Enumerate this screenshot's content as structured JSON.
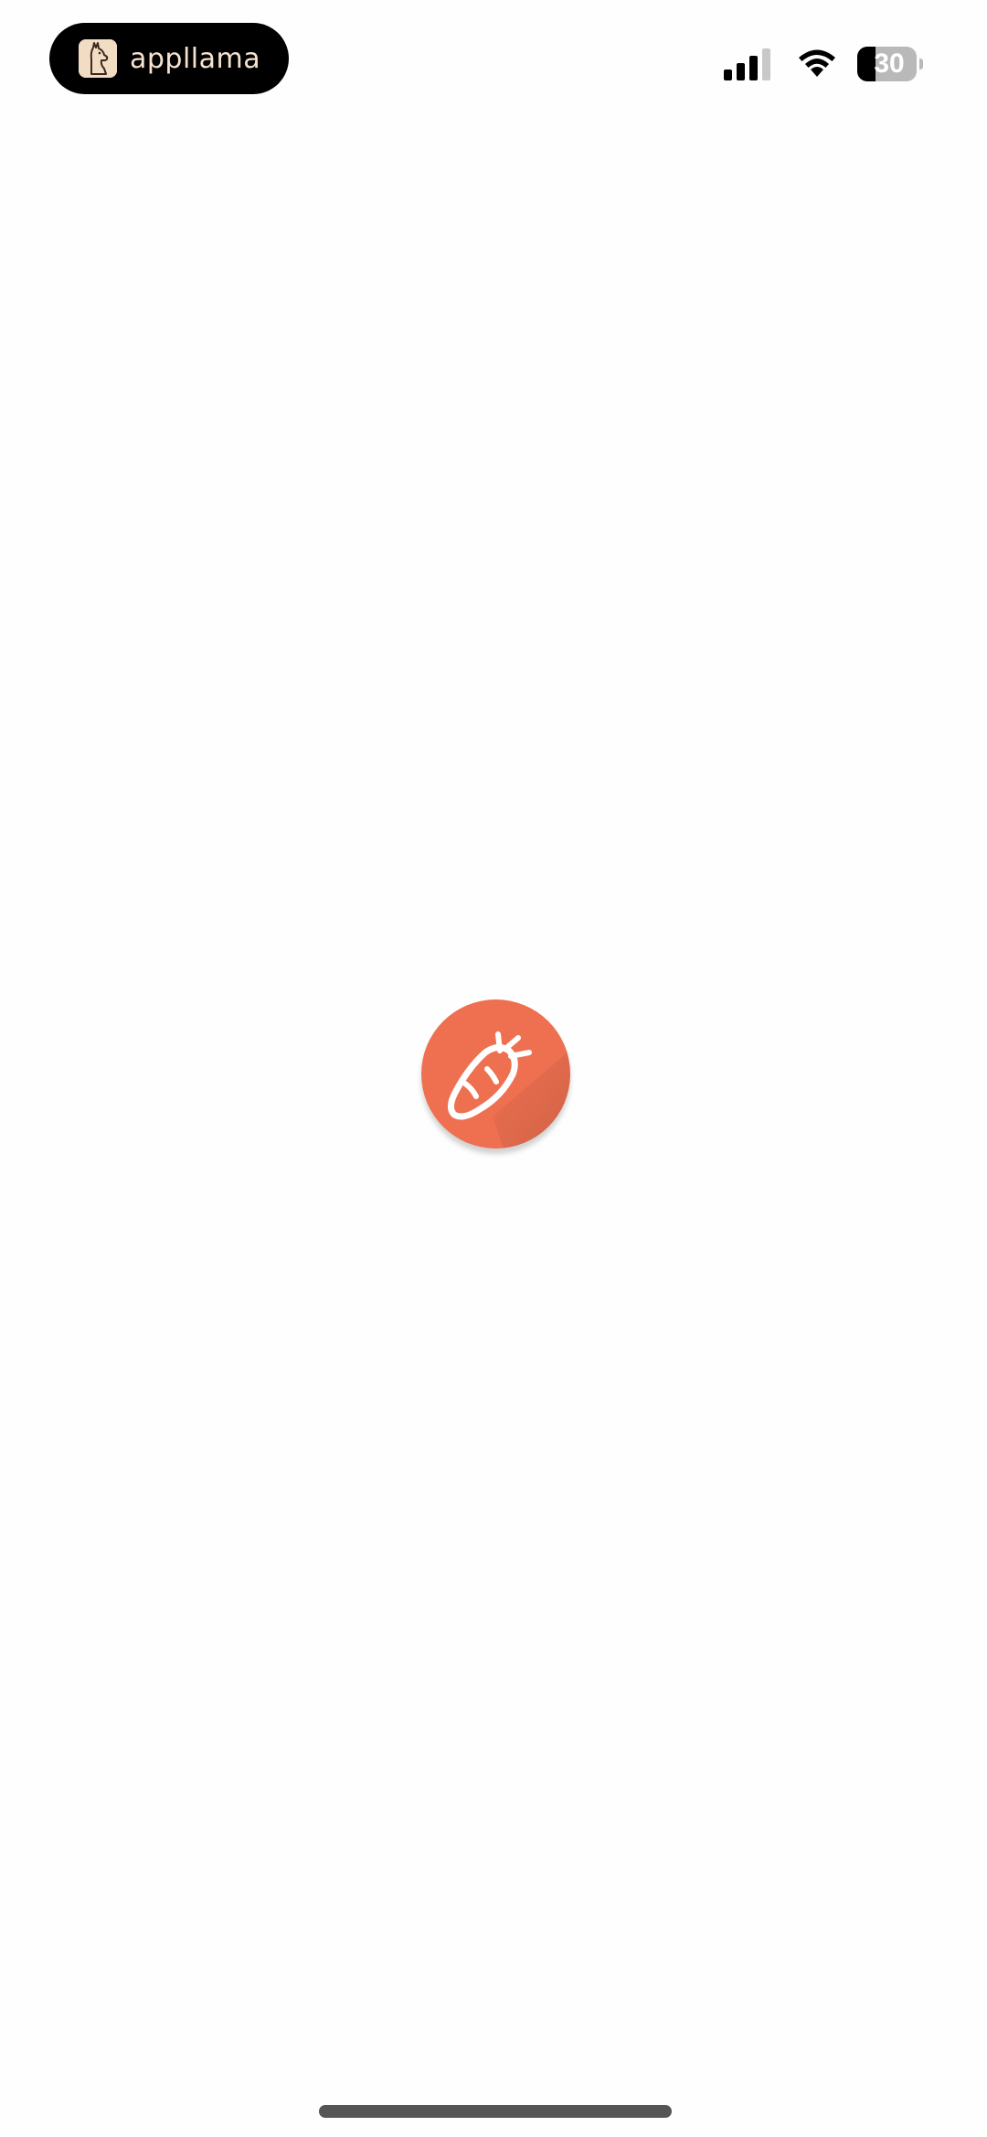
{
  "status_bar": {
    "brand_name": "appllama",
    "brand_logo_icon": "llama-icon",
    "signal_bars_active": 3,
    "signal_bars_total": 4,
    "wifi_icon": "wifi-icon",
    "battery_percent": "30",
    "battery_level": 0.3
  },
  "splash": {
    "logo_icon": "carrot-icon",
    "brand_color": "#ee7050"
  },
  "colors": {
    "background": "#fefefe",
    "pill": "#000000",
    "home_indicator": "#555555"
  }
}
